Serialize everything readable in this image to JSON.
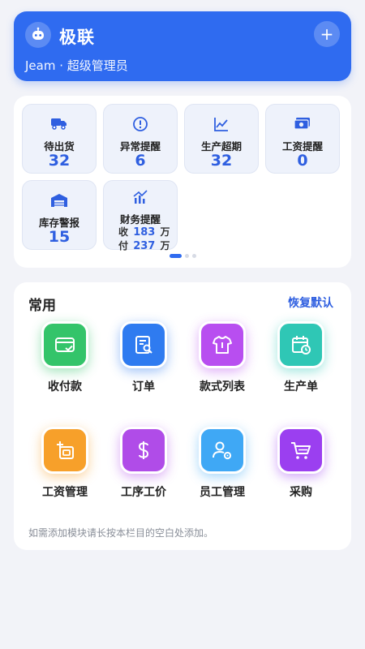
{
  "header": {
    "title": "极联",
    "subtitle": "Jeam · 超级管理员",
    "add_label": "+",
    "color": "#2f6bf0",
    "logo_icon": "robot-icon"
  },
  "stats": [
    {
      "label": "待出货",
      "value": "32",
      "icon": "truck-icon"
    },
    {
      "label": "异常提醒",
      "value": "6",
      "icon": "alert-circle-icon"
    },
    {
      "label": "生产超期",
      "value": "32",
      "icon": "line-chart-icon"
    },
    {
      "label": "工资提醒",
      "value": "0",
      "icon": "money-icon"
    },
    {
      "label": "库存警报",
      "value": "15",
      "icon": "warehouse-icon"
    }
  ],
  "finance": {
    "label": "财务提醒",
    "icon": "trend-icon",
    "income_prefix": "收",
    "income_value": "183",
    "income_unit": "万",
    "expense_prefix": "付",
    "expense_value": "237",
    "expense_unit": "万"
  },
  "pager": {
    "count": 3,
    "active": 0
  },
  "shortcuts": {
    "title": "常用",
    "reset_label": "恢复默认",
    "hint": "如需添加模块请长按本栏目的空白处添加。",
    "items": [
      {
        "label": "收付款",
        "color": "#34c46a",
        "icon": "card-icon"
      },
      {
        "label": "订单",
        "color": "#2f7bf0",
        "icon": "order-icon"
      },
      {
        "label": "款式列表",
        "color": "#b84ef0",
        "icon": "shirt-icon"
      },
      {
        "label": "生产单",
        "color": "#2fc7b5",
        "icon": "calendar-clock-icon"
      },
      {
        "label": "工资管理",
        "color": "#f7a02a",
        "icon": "salary-icon"
      },
      {
        "label": "工序工价",
        "color": "#b04ce8",
        "icon": "dollar-icon"
      },
      {
        "label": "员工管理",
        "color": "#3fa8f5",
        "icon": "user-gear-icon"
      },
      {
        "label": "采购",
        "color": "#9b3ff0",
        "icon": "cart-icon"
      }
    ]
  }
}
